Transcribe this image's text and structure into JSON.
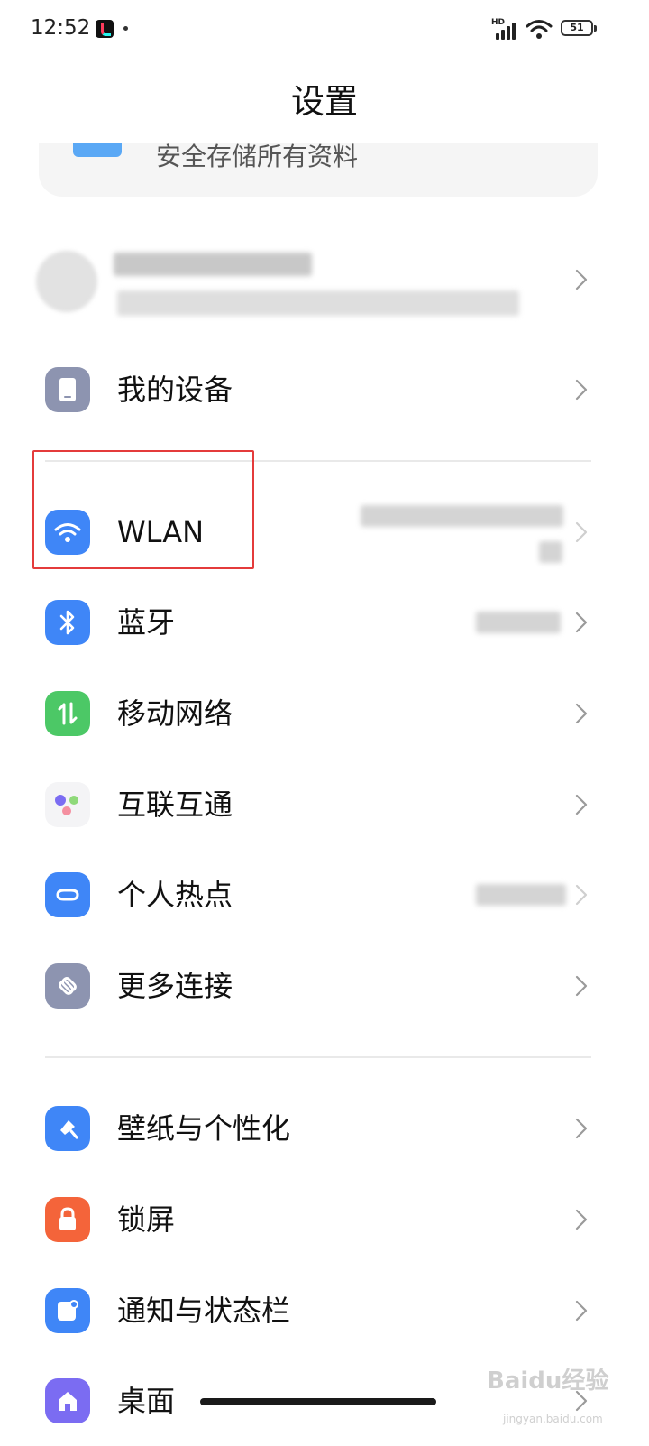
{
  "status_bar": {
    "time": "12:52",
    "network_label": "HD",
    "battery": "51"
  },
  "header": {
    "title": "设置"
  },
  "cloud_card": {
    "subtitle": "安全存储所有资料"
  },
  "rows": {
    "my_device": {
      "label": "我的设备",
      "icon": "phone-icon"
    },
    "wlan": {
      "label": "WLAN",
      "icon": "wifi-icon"
    },
    "bluetooth": {
      "label": "蓝牙",
      "icon": "bluetooth-icon"
    },
    "mobile_network": {
      "label": "移动网络",
      "icon": "mobile-data-icon"
    },
    "interconnect": {
      "label": "互联互通",
      "icon": "interconnect-icon"
    },
    "hotspot": {
      "label": "个人热点",
      "icon": "hotspot-icon"
    },
    "more_connections": {
      "label": "更多连接",
      "icon": "link-icon"
    },
    "wallpaper": {
      "label": "壁纸与个性化",
      "icon": "paint-brush-icon"
    },
    "lock_screen": {
      "label": "锁屏",
      "icon": "lock-icon"
    },
    "notifications": {
      "label": "通知与状态栏",
      "icon": "notification-icon"
    },
    "desktop": {
      "label": "桌面",
      "icon": "home-icon"
    }
  },
  "colors": {
    "device": "#8d94b0",
    "wlan": "#3f86f7",
    "bluetooth": "#3f86f7",
    "mobile_network": "#4cc866",
    "hotspot": "#3f86f7",
    "more_connections": "#8d94b0",
    "wallpaper": "#3f86f7",
    "lock": "#f4643a",
    "notifications": "#3f86f7",
    "desktop": "#7b6cf2",
    "highlight": "#e43b3b"
  },
  "watermark": {
    "text": "Baidu经验",
    "sub": "jingyan.baidu.com"
  }
}
